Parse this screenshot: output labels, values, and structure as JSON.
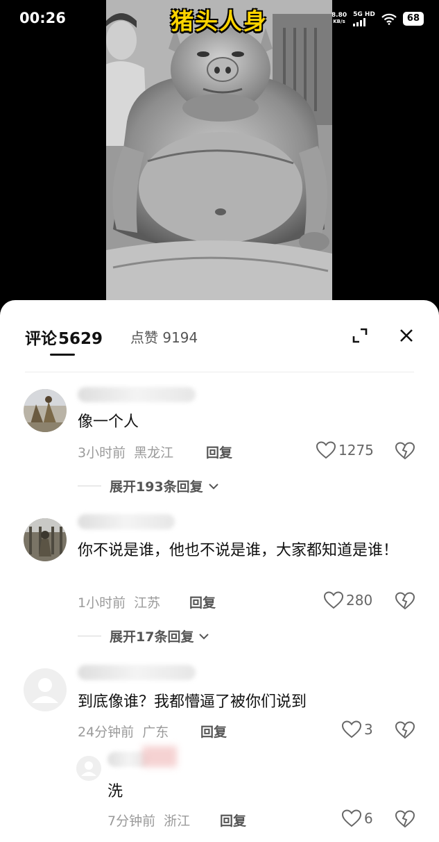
{
  "status_bar": {
    "time": "00:26",
    "net_speed": "8.80",
    "net_unit": "KB/s",
    "net_type": "5G HD",
    "battery": "68"
  },
  "video": {
    "title": "猪头人身"
  },
  "comments_panel": {
    "comments_tab": "评论",
    "comments_count": "5629",
    "likes_tab": "点赞",
    "likes_count": "9194"
  },
  "comments": [
    {
      "text": "像一个人",
      "time": "3小时前",
      "location": "黑龙江",
      "reply_label": "回复",
      "likes": "1275",
      "expand_replies": "展开193条回复"
    },
    {
      "text": "你不说是谁，他也不说是谁，大家都知道是谁！",
      "time": "1小时前",
      "location": "江苏",
      "reply_label": "回复",
      "likes": "280",
      "expand_replies": "展开17条回复"
    },
    {
      "text": "到底像谁？我都懵逼了被你们说到",
      "time": "24分钟前",
      "location": "广东",
      "reply_label": "回复",
      "likes": "3"
    }
  ],
  "reply": {
    "text": "洗",
    "time": "7分钟前",
    "location": "浙江",
    "reply_label": "回复",
    "likes": "6"
  },
  "colors": {
    "title_yellow": "#ffd400",
    "sheet_bg": "#ffffff",
    "meta_gray": "#9a9a9a"
  }
}
